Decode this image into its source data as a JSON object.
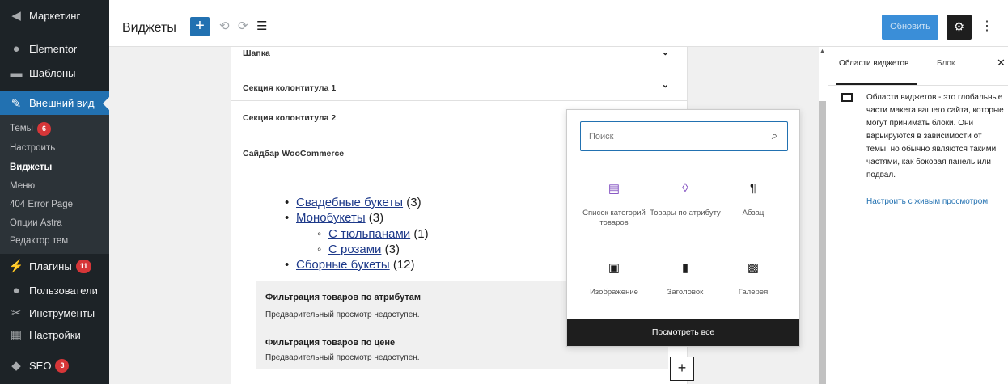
{
  "admin_menu": {
    "items_top": [
      {
        "label": "Маркетинг",
        "icon": "megaphone-icon"
      },
      {
        "label": "Elementor",
        "icon": "elementor-icon"
      },
      {
        "label": "Шаблоны",
        "icon": "folder-icon"
      }
    ],
    "active_item": {
      "label": "Внешний вид",
      "icon": "paintbrush-icon"
    },
    "submenu": [
      {
        "label": "Темы",
        "badge": "6"
      },
      {
        "label": "Настроить"
      },
      {
        "label": "Виджеты",
        "current": true
      },
      {
        "label": "Меню"
      },
      {
        "label": "404 Error Page"
      },
      {
        "label": "Опции Astra"
      },
      {
        "label": "Редактор тем"
      }
    ],
    "items_bottom": [
      {
        "label": "Плагины",
        "icon": "plugin-icon",
        "badge": "11"
      },
      {
        "label": "Пользователи",
        "icon": "users-icon"
      },
      {
        "label": "Инструменты",
        "icon": "wrench-icon"
      },
      {
        "label": "Настройки",
        "icon": "settings-icon"
      },
      {
        "label": "SEO",
        "icon": "seo-icon",
        "badge": "3"
      }
    ]
  },
  "topbar": {
    "title": "Виджеты",
    "add_symbol": "+",
    "undo_symbol": "⟲",
    "redo_symbol": "⟳",
    "list_view_symbol": "☰",
    "update_label": "Обновить",
    "settings_symbol": "⚙",
    "more_symbol": "⋮"
  },
  "sections": [
    {
      "label": "Шапка",
      "chevron": "⌄"
    },
    {
      "label": "Секция колонтитула 1",
      "chevron": "⌄"
    },
    {
      "label": "Секция колонтитула 2",
      "chevron": ""
    }
  ],
  "woocommerce_sidebar": {
    "title": "Сайдбар WooCommerce",
    "categories": [
      {
        "name": "Свадебные букеты",
        "count": "(3)",
        "level": 0
      },
      {
        "name": "Монобукеты",
        "count": "(3)",
        "level": 0
      },
      {
        "name": "С тюльпанами",
        "count": "(1)",
        "level": 1
      },
      {
        "name": "С розами",
        "count": "(3)",
        "level": 1
      },
      {
        "name": "Сборные букеты",
        "count": "(12)",
        "level": 0
      }
    ],
    "filters": [
      {
        "title": "Фильтрация товаров по атрибутам",
        "desc": "Предварительный просмотр недоступен."
      },
      {
        "title": "Фильтрация товаров по цене",
        "desc": "Предварительный просмотр недоступен."
      }
    ]
  },
  "inserter": {
    "search_placeholder": "Поиск",
    "blocks": [
      {
        "label": "Список категорий товаров",
        "icon": "category-list-icon",
        "glyph": "▤",
        "color": "#7a44bd"
      },
      {
        "label": "Товары по атрибуту",
        "icon": "product-attribute-icon",
        "glyph": "◊",
        "color": "#7a44bd"
      },
      {
        "label": "Абзац",
        "icon": "paragraph-icon",
        "glyph": "¶",
        "color": "#1e1e1e"
      },
      {
        "label": "Изображение",
        "icon": "image-icon",
        "glyph": "▣",
        "color": "#1e1e1e"
      },
      {
        "label": "Заголовок",
        "icon": "bookmark-icon",
        "glyph": "▮",
        "color": "#1e1e1e"
      },
      {
        "label": "Галерея",
        "icon": "gallery-icon",
        "glyph": "▩",
        "color": "#1e1e1e"
      }
    ],
    "view_all_label": "Посмотреть все"
  },
  "canvas_add_symbol": "+",
  "panel": {
    "tab_areas": "Области виджетов",
    "tab_block": "Блок",
    "close_symbol": "✕",
    "description": "Области виджетов - это глобальные части макета вашего сайта, которые могут принимать блоки. Они варьируются в зависимости от темы, но обычно являются такими частями, как боковая панель или подвал.",
    "link": "Настроить с живым просмотром"
  },
  "colors": {
    "admin_bg": "#1d2327",
    "accent": "#2271b1",
    "badge": "#d63638"
  }
}
